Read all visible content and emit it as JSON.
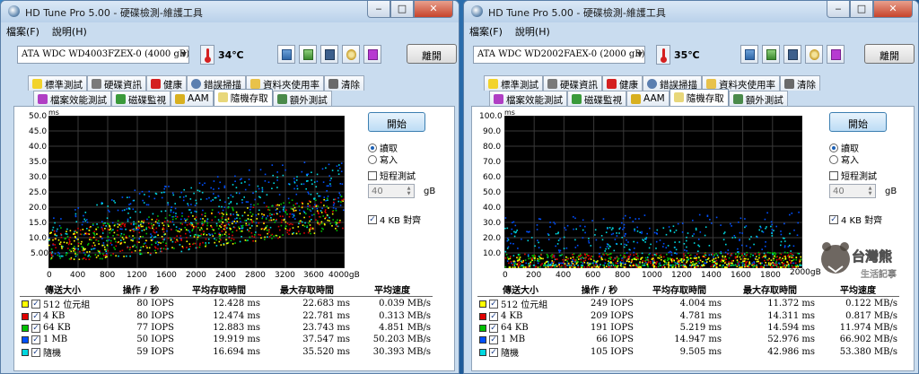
{
  "colors": {
    "yellow": "#ffff00",
    "red": "#e00000",
    "green": "#00c000",
    "blue": "#0050ff",
    "cyan": "#00d8e0"
  },
  "windows": [
    {
      "title": "HD Tune Pro  5.00 - 硬碟檢測-維護工具",
      "menu": [
        "檔案(F)",
        "說明(H)"
      ],
      "drive": "ATA    WDC WD4003FZEX-0 (4000 gB)",
      "temperature": "34℃",
      "exit_label": "離開",
      "tabs_row1": [
        "標準測試",
        "硬碟資訊",
        "健康",
        "錯誤掃描",
        "資料夾使用率",
        "清除"
      ],
      "tabs_row2": [
        "檔案效能測試",
        "磁碟監視",
        "AAM",
        "隨機存取",
        "額外測試"
      ],
      "start_label": "開始",
      "read_label": "讀取",
      "write_label": "寫入",
      "short_test_label": "短程測試",
      "short_test_value": "40",
      "gb_unit": "gB",
      "align_label": "4 KB 對齊",
      "y_unit": "ms",
      "y_ticks": [
        "50.0",
        "45.0",
        "40.0",
        "35.0",
        "30.0",
        "25.0",
        "20.0",
        "15.0",
        "10.0",
        "5.00"
      ],
      "x_ticks": [
        "0",
        "400",
        "800",
        "1200",
        "1600",
        "2000",
        "2400",
        "2800",
        "3200",
        "3600",
        "4000gB"
      ],
      "table_headers": [
        "傳送大小",
        "操作 / 秒",
        "平均存取時間",
        "最大存取時間",
        "平均速度"
      ],
      "rows": [
        {
          "label": "512 位元組",
          "ops": "80 IOPS",
          "avg": "12.428 ms",
          "max": "22.683 ms",
          "speed": "0.039 MB/s",
          "color": "#ffff00"
        },
        {
          "label": "4 KB",
          "ops": "80 IOPS",
          "avg": "12.474 ms",
          "max": "22.781 ms",
          "speed": "0.313 MB/s",
          "color": "#e00000"
        },
        {
          "label": "64 KB",
          "ops": "77 IOPS",
          "avg": "12.883 ms",
          "max": "23.743 ms",
          "speed": "4.851 MB/s",
          "color": "#00c000"
        },
        {
          "label": "1 MB",
          "ops": "50 IOPS",
          "avg": "19.919 ms",
          "max": "37.547 ms",
          "speed": "50.203 MB/s",
          "color": "#0050ff"
        },
        {
          "label": "隨機",
          "ops": "59 IOPS",
          "avg": "16.694 ms",
          "max": "35.520 ms",
          "speed": "30.393 MB/s",
          "color": "#00d8e0"
        }
      ]
    },
    {
      "title": "HD Tune Pro  5.00 - 硬碟檢測-維護工具",
      "menu": [
        "檔案(F)",
        "說明(H)"
      ],
      "drive": "ATA    WDC WD2002FAEX-0 (2000 gB)",
      "temperature": "35℃",
      "exit_label": "離開",
      "tabs_row1": [
        "標準測試",
        "硬碟資訊",
        "健康",
        "錯誤掃描",
        "資料夾使用率",
        "清除"
      ],
      "tabs_row2": [
        "檔案效能測試",
        "磁碟監視",
        "AAM",
        "隨機存取",
        "額外測試"
      ],
      "start_label": "開始",
      "read_label": "讀取",
      "write_label": "寫入",
      "short_test_label": "短程測試",
      "short_test_value": "40",
      "gb_unit": "gB",
      "align_label": "4 KB 對齊",
      "y_unit": "ms",
      "y_ticks": [
        "100.0",
        "90.0",
        "80.0",
        "70.0",
        "60.0",
        "50.0",
        "40.0",
        "30.0",
        "20.0",
        "10.0"
      ],
      "x_ticks": [
        "0",
        "200",
        "400",
        "600",
        "800",
        "1000",
        "1200",
        "1400",
        "1600",
        "1800",
        "2000gB"
      ],
      "table_headers": [
        "傳送大小",
        "操作 / 秒",
        "平均存取時間",
        "最大存取時間",
        "平均速度"
      ],
      "rows": [
        {
          "label": "512 位元組",
          "ops": "249 IOPS",
          "avg": "4.004 ms",
          "max": "11.372 ms",
          "speed": "0.122 MB/s",
          "color": "#ffff00"
        },
        {
          "label": "4 KB",
          "ops": "209 IOPS",
          "avg": "4.781 ms",
          "max": "14.311 ms",
          "speed": "0.817 MB/s",
          "color": "#e00000"
        },
        {
          "label": "64 KB",
          "ops": "191 IOPS",
          "avg": "5.219 ms",
          "max": "14.594 ms",
          "speed": "11.974 MB/s",
          "color": "#00c000"
        },
        {
          "label": "1 MB",
          "ops": "66 IOPS",
          "avg": "14.947 ms",
          "max": "52.976 ms",
          "speed": "66.902 MB/s",
          "color": "#0050ff"
        },
        {
          "label": "隨機",
          "ops": "105 IOPS",
          "avg": "9.505 ms",
          "max": "42.986 ms",
          "speed": "53.380 MB/s",
          "color": "#00d8e0"
        }
      ]
    }
  ],
  "chart_data": [
    {
      "type": "scatter",
      "xlabel": "gB",
      "ylabel": "ms",
      "xlim": [
        0,
        4000
      ],
      "ylim": [
        0,
        50
      ],
      "grid": true,
      "series": [
        {
          "name": "512 位元組",
          "avg_ms": 12.428,
          "max_ms": 22.683
        },
        {
          "name": "4 KB",
          "avg_ms": 12.474,
          "max_ms": 22.781
        },
        {
          "name": "64 KB",
          "avg_ms": 12.883,
          "max_ms": 23.743
        },
        {
          "name": "1 MB",
          "avg_ms": 19.919,
          "max_ms": 37.547
        },
        {
          "name": "隨機",
          "avg_ms": 16.694,
          "max_ms": 35.52
        }
      ]
    },
    {
      "type": "scatter",
      "xlabel": "gB",
      "ylabel": "ms",
      "xlim": [
        0,
        2000
      ],
      "ylim": [
        0,
        100
      ],
      "grid": true,
      "series": [
        {
          "name": "512 位元組",
          "avg_ms": 4.004,
          "max_ms": 11.372
        },
        {
          "name": "4 KB",
          "avg_ms": 4.781,
          "max_ms": 14.311
        },
        {
          "name": "64 KB",
          "avg_ms": 5.219,
          "max_ms": 14.594
        },
        {
          "name": "1 MB",
          "avg_ms": 14.947,
          "max_ms": 52.976
        },
        {
          "name": "隨機",
          "avg_ms": 9.505,
          "max_ms": 42.986
        }
      ]
    }
  ],
  "watermark": {
    "text": "台灣熊 生活記事"
  }
}
